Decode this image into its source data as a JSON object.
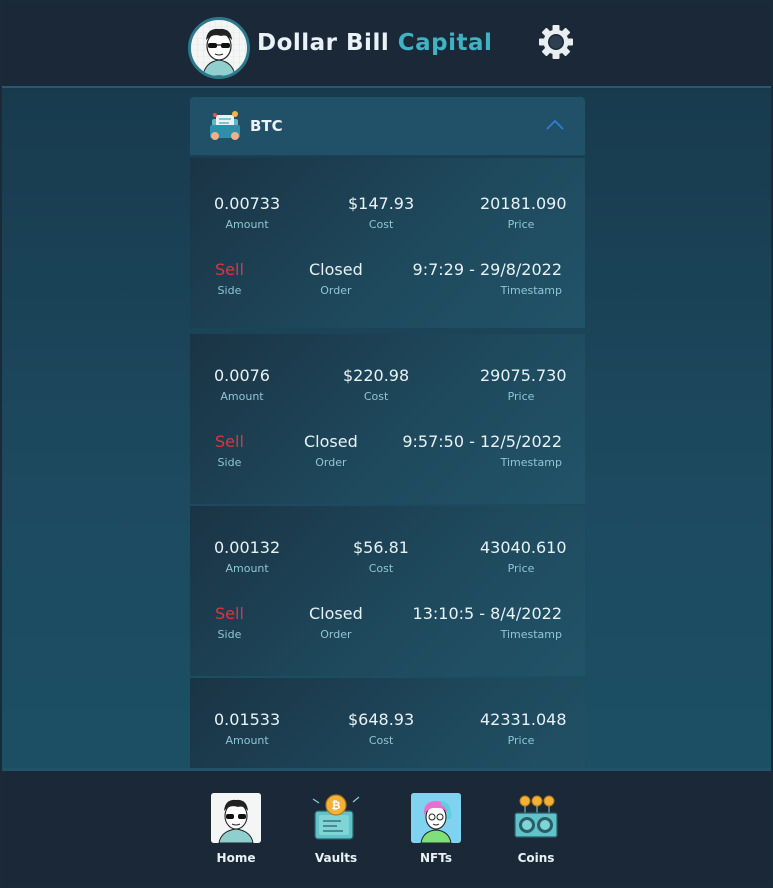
{
  "header": {
    "brand_part1": "Dollar Bill",
    "brand_part2": "Capital",
    "avatar_icon": "cartoon-sunglasses-avatar",
    "settings_icon": "gear-icon"
  },
  "panel": {
    "title": "BTC",
    "icon": "coin-folder-icon",
    "expanded": true
  },
  "labels": {
    "amount": "Amount",
    "cost": "Cost",
    "price": "Price",
    "side": "Side",
    "order": "Order",
    "timestamp": "Timestamp"
  },
  "trades": [
    {
      "amount": "0.00733",
      "cost": "$147.93",
      "price": "20181.090",
      "side": "Sell",
      "order": "Closed",
      "timestamp": "9:7:29 - 29/8/2022"
    },
    {
      "amount": "0.0076",
      "cost": "$220.98",
      "price": "29075.730",
      "side": "Sell",
      "order": "Closed",
      "timestamp": "9:57:50 - 12/5/2022"
    },
    {
      "amount": "0.00132",
      "cost": "$56.81",
      "price": "43040.610",
      "side": "Sell",
      "order": "Closed",
      "timestamp": "13:10:5 - 8/4/2022"
    },
    {
      "amount": "0.01533",
      "cost": "$648.93",
      "price": "42331.048",
      "side": "",
      "order": "",
      "timestamp": ""
    }
  ],
  "nav": [
    {
      "label": "Home",
      "icon": "avatar-home-icon"
    },
    {
      "label": "Vaults",
      "icon": "bitcoin-vault-icon"
    },
    {
      "label": "NFTs",
      "icon": "nft-character-icon"
    },
    {
      "label": "Coins",
      "icon": "mining-rig-icon"
    }
  ],
  "colors": {
    "accent": "#3fb2c3",
    "sell": "#e0343d",
    "header_bg": "#1a2838"
  }
}
